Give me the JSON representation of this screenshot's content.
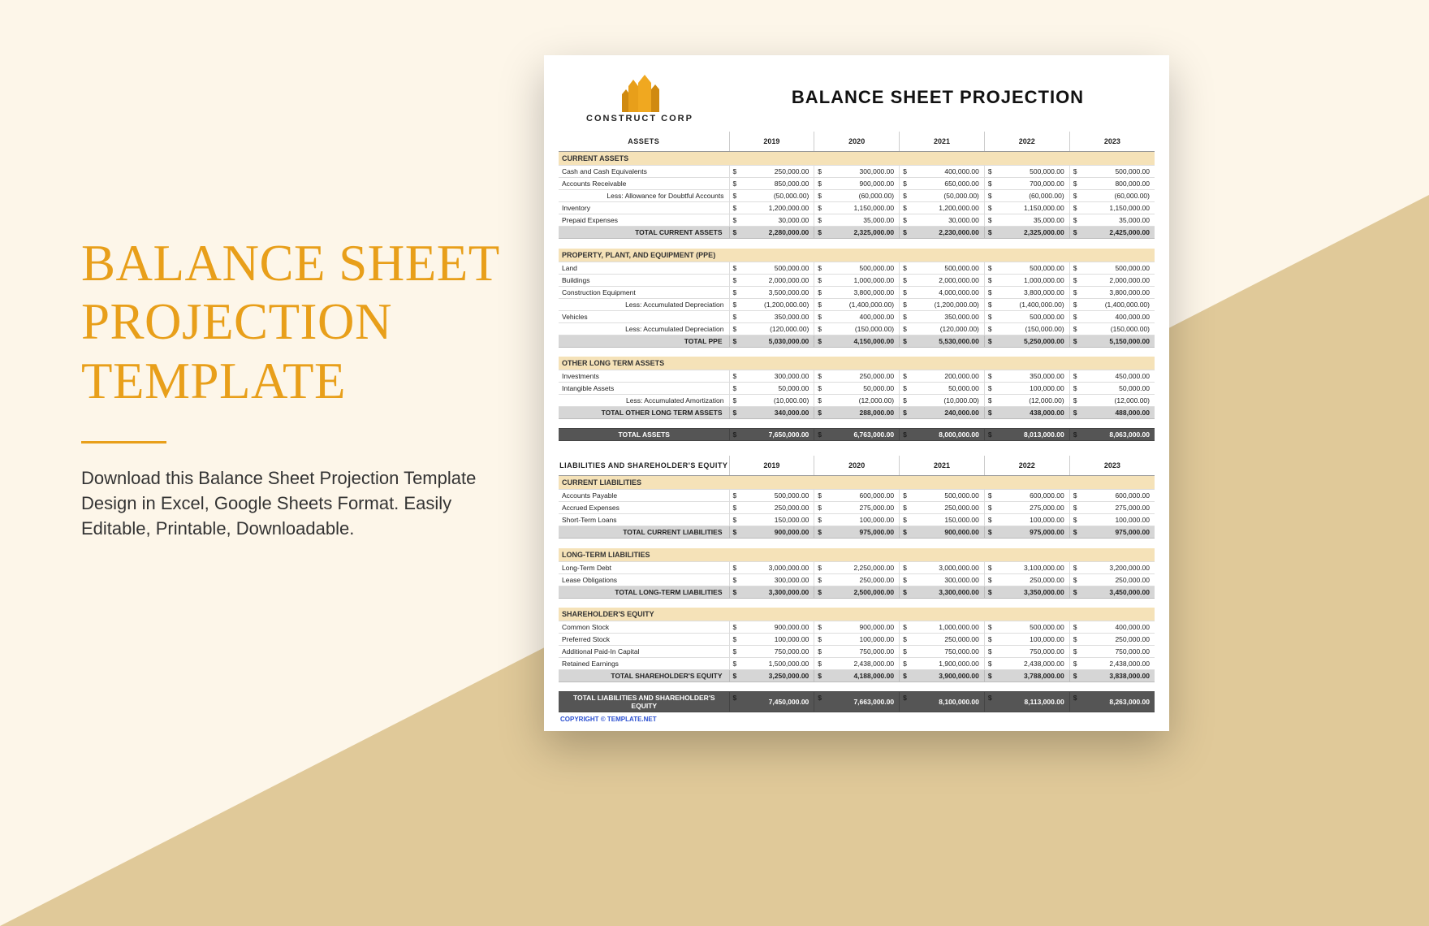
{
  "promo": {
    "title_l1": "BALANCE SHEET",
    "title_l2": "PROJECTION",
    "title_l3": "TEMPLATE",
    "desc": "Download this Balance Sheet Projection Template Design in Excel, Google Sheets Format. Easily Editable, Printable, Downloadable."
  },
  "sheet": {
    "company": "CONSTRUCT CORP",
    "title": "BALANCE SHEET PROJECTION",
    "years": [
      "2019",
      "2020",
      "2021",
      "2022",
      "2023"
    ],
    "copyright": "COPYRIGHT © TEMPLATE.NET",
    "sec_assets": "ASSETS",
    "sec_liab": "LIABILITIES AND SHAREHOLDER'S EQUITY",
    "chart_data": {
      "type": "table",
      "sections": [
        {
          "header": "CURRENT ASSETS",
          "rows": [
            {
              "label": "Cash and Cash Equivalents",
              "v": [
                "250,000.00",
                "300,000.00",
                "400,000.00",
                "500,000.00",
                "500,000.00"
              ]
            },
            {
              "label": "Accounts Receivable",
              "v": [
                "850,000.00",
                "900,000.00",
                "650,000.00",
                "700,000.00",
                "800,000.00"
              ]
            },
            {
              "label": "Less: Allowance for Doubtful Accounts",
              "indent": true,
              "v": [
                "(50,000.00)",
                "(60,000.00)",
                "(50,000.00)",
                "(60,000.00)",
                "(60,000.00)"
              ]
            },
            {
              "label": "Inventory",
              "v": [
                "1,200,000.00",
                "1,150,000.00",
                "1,200,000.00",
                "1,150,000.00",
                "1,150,000.00"
              ]
            },
            {
              "label": "Prepaid Expenses",
              "v": [
                "30,000.00",
                "35,000.00",
                "30,000.00",
                "35,000.00",
                "35,000.00"
              ]
            }
          ],
          "total": {
            "label": "TOTAL CURRENT ASSETS",
            "v": [
              "2,280,000.00",
              "2,325,000.00",
              "2,230,000.00",
              "2,325,000.00",
              "2,425,000.00"
            ]
          }
        },
        {
          "header": "PROPERTY, PLANT, AND EQUIPMENT (PPE)",
          "rows": [
            {
              "label": "Land",
              "v": [
                "500,000.00",
                "500,000.00",
                "500,000.00",
                "500,000.00",
                "500,000.00"
              ]
            },
            {
              "label": "Buildings",
              "v": [
                "2,000,000.00",
                "1,000,000.00",
                "2,000,000.00",
                "1,000,000.00",
                "2,000,000.00"
              ]
            },
            {
              "label": "Construction Equipment",
              "v": [
                "3,500,000.00",
                "3,800,000.00",
                "4,000,000.00",
                "3,800,000.00",
                "3,800,000.00"
              ]
            },
            {
              "label": "Less: Accumulated Depreciation",
              "indent": true,
              "v": [
                "(1,200,000.00)",
                "(1,400,000.00)",
                "(1,200,000.00)",
                "(1,400,000.00)",
                "(1,400,000.00)"
              ]
            },
            {
              "label": "Vehicles",
              "v": [
                "350,000.00",
                "400,000.00",
                "350,000.00",
                "500,000.00",
                "400,000.00"
              ]
            },
            {
              "label": "Less: Accumulated Depreciation",
              "indent": true,
              "v": [
                "(120,000.00)",
                "(150,000.00)",
                "(120,000.00)",
                "(150,000.00)",
                "(150,000.00)"
              ]
            }
          ],
          "total": {
            "label": "TOTAL PPE",
            "v": [
              "5,030,000.00",
              "4,150,000.00",
              "5,530,000.00",
              "5,250,000.00",
              "5,150,000.00"
            ]
          }
        },
        {
          "header": "OTHER LONG TERM ASSETS",
          "rows": [
            {
              "label": "Investments",
              "v": [
                "300,000.00",
                "250,000.00",
                "200,000.00",
                "350,000.00",
                "450,000.00"
              ]
            },
            {
              "label": "Intangible Assets",
              "v": [
                "50,000.00",
                "50,000.00",
                "50,000.00",
                "100,000.00",
                "50,000.00"
              ]
            },
            {
              "label": "Less: Accumulated Amortization",
              "indent": true,
              "v": [
                "(10,000.00)",
                "(12,000.00)",
                "(10,000.00)",
                "(12,000.00)",
                "(12,000.00)"
              ]
            }
          ],
          "total": {
            "label": "TOTAL OTHER LONG TERM ASSETS",
            "v": [
              "340,000.00",
              "288,000.00",
              "240,000.00",
              "438,000.00",
              "488,000.00"
            ]
          }
        }
      ],
      "grand_assets": {
        "label": "TOTAL ASSETS",
        "v": [
          "7,650,000.00",
          "6,763,000.00",
          "8,000,000.00",
          "8,013,000.00",
          "8,063,000.00"
        ]
      },
      "liab_sections": [
        {
          "header": "CURRENT LIABILITIES",
          "rows": [
            {
              "label": "Accounts Payable",
              "v": [
                "500,000.00",
                "600,000.00",
                "500,000.00",
                "600,000.00",
                "600,000.00"
              ]
            },
            {
              "label": "Accrued Expenses",
              "v": [
                "250,000.00",
                "275,000.00",
                "250,000.00",
                "275,000.00",
                "275,000.00"
              ]
            },
            {
              "label": "Short-Term Loans",
              "v": [
                "150,000.00",
                "100,000.00",
                "150,000.00",
                "100,000.00",
                "100,000.00"
              ]
            }
          ],
          "total": {
            "label": "TOTAL CURRENT LIABILITIES",
            "v": [
              "900,000.00",
              "975,000.00",
              "900,000.00",
              "975,000.00",
              "975,000.00"
            ]
          }
        },
        {
          "header": "LONG-TERM LIABILITIES",
          "rows": [
            {
              "label": "Long-Term Debt",
              "v": [
                "3,000,000.00",
                "2,250,000.00",
                "3,000,000.00",
                "3,100,000.00",
                "3,200,000.00"
              ]
            },
            {
              "label": "Lease Obligations",
              "v": [
                "300,000.00",
                "250,000.00",
                "300,000.00",
                "250,000.00",
                "250,000.00"
              ]
            }
          ],
          "total": {
            "label": "TOTAL LONG-TERM LIABILITIES",
            "v": [
              "3,300,000.00",
              "2,500,000.00",
              "3,300,000.00",
              "3,350,000.00",
              "3,450,000.00"
            ]
          }
        },
        {
          "header": "SHAREHOLDER'S EQUITY",
          "rows": [
            {
              "label": "Common Stock",
              "v": [
                "900,000.00",
                "900,000.00",
                "1,000,000.00",
                "500,000.00",
                "400,000.00"
              ]
            },
            {
              "label": "Preferred Stock",
              "v": [
                "100,000.00",
                "100,000.00",
                "250,000.00",
                "100,000.00",
                "250,000.00"
              ]
            },
            {
              "label": "Additional Paid-In Capital",
              "v": [
                "750,000.00",
                "750,000.00",
                "750,000.00",
                "750,000.00",
                "750,000.00"
              ]
            },
            {
              "label": "Retained Earnings",
              "v": [
                "1,500,000.00",
                "2,438,000.00",
                "1,900,000.00",
                "2,438,000.00",
                "2,438,000.00"
              ]
            }
          ],
          "total": {
            "label": "TOTAL SHAREHOLDER'S EQUITY",
            "v": [
              "3,250,000.00",
              "4,188,000.00",
              "3,900,000.00",
              "3,788,000.00",
              "3,838,000.00"
            ]
          }
        }
      ],
      "grand_liab": {
        "label": "TOTAL LIABILITIES AND SHAREHOLDER'S EQUITY",
        "v": [
          "7,450,000.00",
          "7,663,000.00",
          "8,100,000.00",
          "8,113,000.00",
          "8,263,000.00"
        ]
      }
    }
  }
}
